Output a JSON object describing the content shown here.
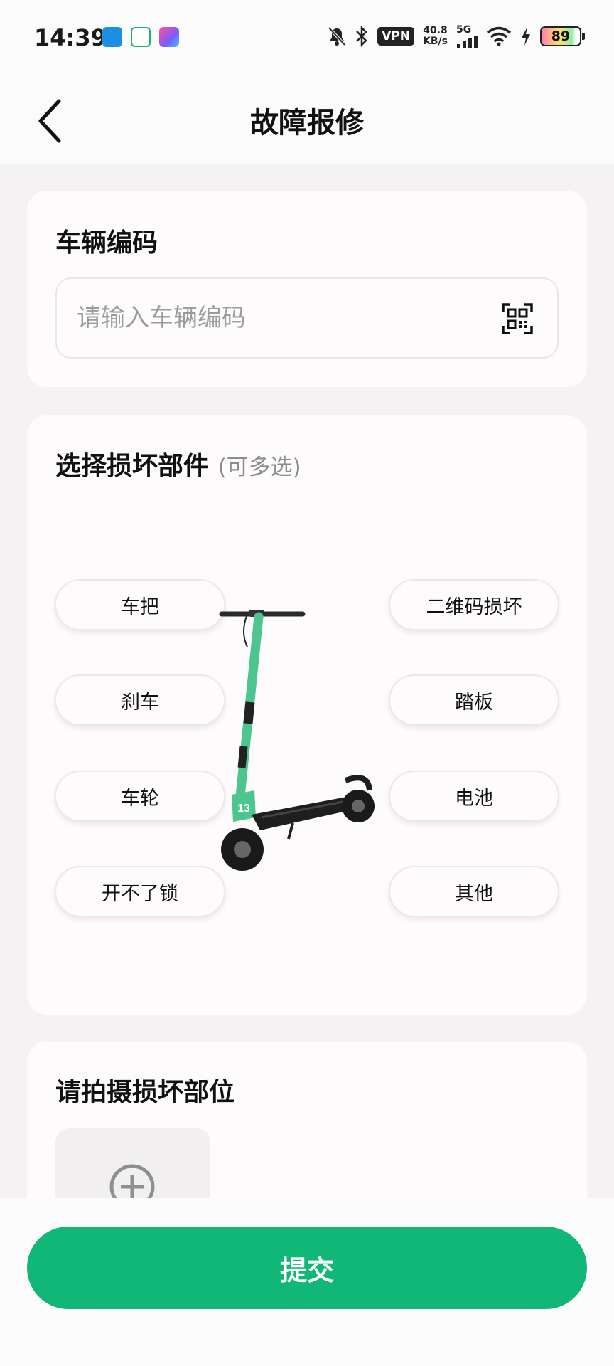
{
  "status_bar": {
    "time": "14:39",
    "vpn": "VPN",
    "speed_value": "40.8",
    "speed_unit": "KB/s",
    "network": "5G",
    "battery": "89",
    "icons": [
      "usb-icon",
      "home-app-icon",
      "flow-app-icon",
      "mute-bell-icon",
      "bluetooth-icon",
      "signal-icon",
      "wifi-icon",
      "charging-icon"
    ]
  },
  "header": {
    "title": "故障报修",
    "back_icon": "chevron-left-icon"
  },
  "vehicle_code": {
    "title": "车辆编码",
    "value": "",
    "placeholder": "请输入车辆编码",
    "scan_icon": "qr-scan-icon"
  },
  "parts": {
    "title": "选择损坏部件",
    "hint": "(可多选)",
    "left": [
      "车把",
      "刹车",
      "车轮",
      "开不了锁"
    ],
    "right": [
      "二维码损坏",
      "踏板",
      "电池",
      "其他"
    ],
    "image": "scooter-image"
  },
  "photo": {
    "title": "请拍摄损坏部位",
    "add_icon": "plus-circle-icon"
  },
  "submit": {
    "label": "提交"
  },
  "colors": {
    "accent": "#10b777",
    "background": "#f4f2f2",
    "card": "#fdfbfb",
    "scooter_green": "#4cc58f"
  }
}
